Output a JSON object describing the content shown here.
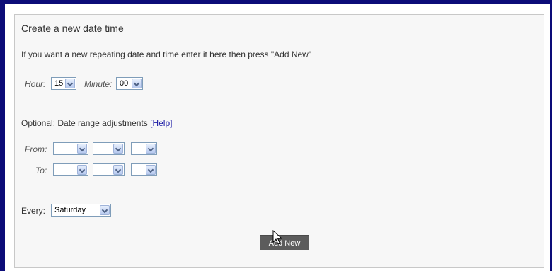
{
  "form": {
    "title": "Create a new date time",
    "intro": "If you want a new repeating date and time enter it here then press \"Add New\"",
    "hour_label": "Hour:",
    "hour_value": "15",
    "minute_label": "Minute:",
    "minute_value": "00",
    "optional_label": "Optional: Date range adjustments",
    "help_link": "[Help]",
    "from_label": "From:",
    "to_label": "To:",
    "from_values": [
      "",
      "",
      ""
    ],
    "to_values": [
      "",
      "",
      ""
    ],
    "every_label": "Every:",
    "every_value": "Saturday",
    "add_new_label": "Add New"
  },
  "colors": {
    "frame": "#0c0c78",
    "panel_bg": "#f7f7f7",
    "button_bg": "#5c5c5c",
    "link": "#1a1aa6"
  },
  "icons": {
    "dropdown": "chevron-down-icon",
    "cursor": "mouse-pointer-icon"
  }
}
